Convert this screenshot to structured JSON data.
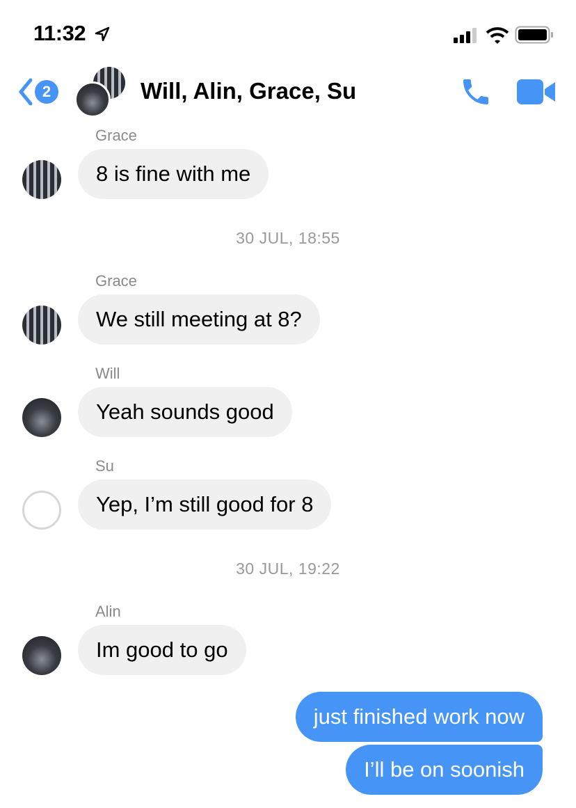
{
  "status": {
    "time": "11:32"
  },
  "header": {
    "back_badge": "2",
    "title": "Will, Alin, Grace, Su"
  },
  "messages": [
    {
      "sender": "Grace",
      "text": "8 is fine with me"
    },
    {
      "timestamp": "30 JUL, 18:55"
    },
    {
      "sender": "Grace",
      "text": "We still meeting at 8?"
    },
    {
      "sender": "Will",
      "text": "Yeah sounds good"
    },
    {
      "sender": "Su",
      "text": "Yep, I’m still good for 8"
    },
    {
      "timestamp": "30 JUL, 19:22"
    },
    {
      "sender": "Alin",
      "text": "Im good to go"
    },
    {
      "text": "just finished work now"
    },
    {
      "text": "I’ll be on soonish"
    }
  ],
  "colors": {
    "accent": "#4694f5",
    "incoming": "#f0f0f0"
  }
}
